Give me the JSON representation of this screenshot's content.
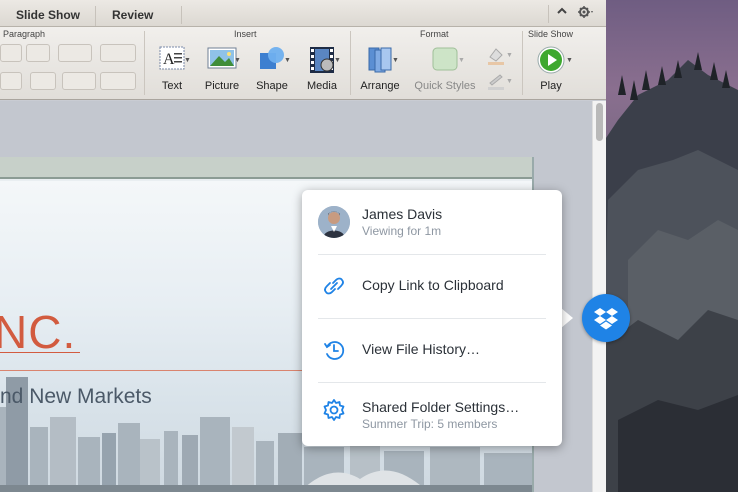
{
  "tabs": [
    "Slide Show",
    "Review"
  ],
  "ribbon": {
    "groups": {
      "paragraph": "Paragraph",
      "insert": "Insert",
      "format": "Format",
      "slideshow": "Slide Show"
    },
    "buttons": {
      "text": "Text",
      "picture": "Picture",
      "shape": "Shape",
      "media": "Media",
      "arrange": "Arrange",
      "quick_styles": "Quick Styles",
      "play": "Play"
    }
  },
  "slide": {
    "title": "NC.",
    "subtitle": "nd New Markets"
  },
  "popup": {
    "user": {
      "name": "James Davis",
      "status": "Viewing for 1m"
    },
    "copy_link": "Copy Link to Clipboard",
    "history": "View File History…",
    "settings": {
      "label": "Shared Folder Settings…",
      "sub": "Summer Trip: 5 members"
    }
  },
  "colors": {
    "accent": "#1f83e6",
    "title": "#d25b3f",
    "play": "#3ea82f"
  }
}
